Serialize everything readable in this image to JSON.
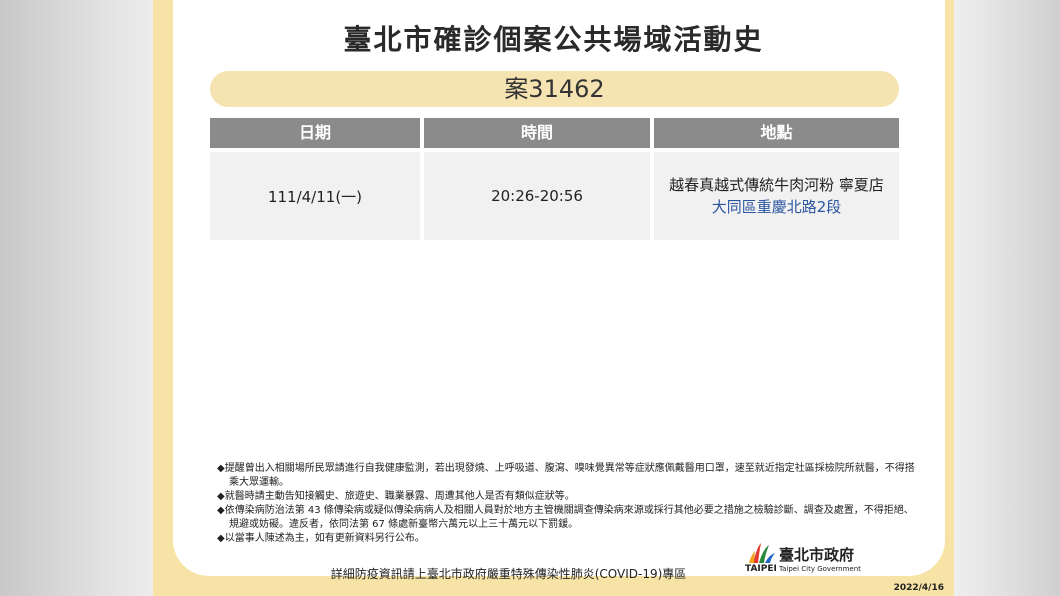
{
  "title": "臺北市確診個案公共場域活動史",
  "case_label": "案31462",
  "table": {
    "headers": [
      "日期",
      "時間",
      "地點"
    ],
    "row": {
      "date": "111/4/11(一)",
      "time": "20:26-20:56",
      "location_name": "越春真越式傳統牛肉河粉 寧夏店",
      "location_address": "大同區重慶北路2段"
    }
  },
  "notes": [
    "◆提醒曾出入相關場所民眾請進行自我健康監測，若出現發燒、上呼吸道、腹瀉、嗅味覺異常等症狀應佩戴醫用口罩，速至就近指定社區採檢院所就醫，不得搭乘大眾運輸。",
    "◆就醫時請主動告知接觸史、旅遊史、職業暴露、周遭其他人是否有類似症狀等。",
    "◆依傳染病防治法第 43 條傳染病或疑似傳染病病人及相關人員對於地方主管機關調查傳染病來源或採行其他必要之措施之檢驗診斷、調查及處置，不得拒絕、規避或妨礙。違反者，依同法第 67 條處新臺幣六萬元以上三十萬元以下罰鍰。",
    "◆以當事人陳述為主，如有更新資料另行公布。"
  ],
  "footer_info": "詳細防疫資訊請上臺北市政府嚴重特殊傳染性肺炎(COVID-19)專區",
  "logo": {
    "name": "臺北市政府",
    "wordmark": "TAIPEI",
    "subtitle": "Taipei City Government",
    "icon": "taipei-logo-icon"
  },
  "date": "2022/4/16",
  "colors": {
    "frame": "#f7e3a6",
    "pill": "#f5e4b2",
    "header": "#8b8b8b",
    "cell": "#f1f1f1",
    "address": "#2a55a0"
  }
}
